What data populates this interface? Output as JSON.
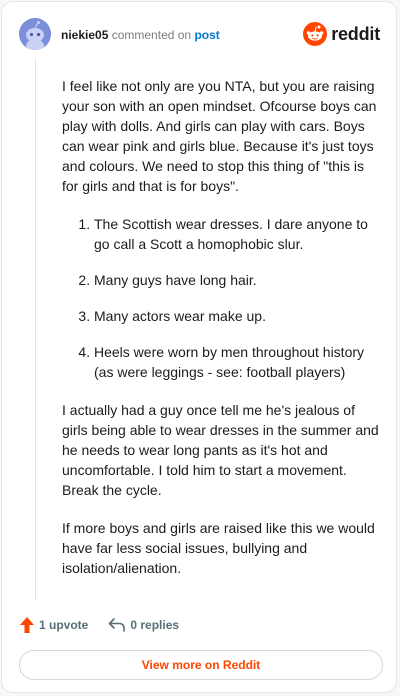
{
  "header": {
    "username": "niekie05",
    "action_text": "commented on",
    "post_link": "post",
    "brand": "reddit"
  },
  "comment": {
    "intro": "I feel like not only are you NTA, but you are raising your son with an open mindset. Ofcourse boys can play with dolls. And girls can play with cars. Boys can wear pink and girls blue. Because it's just toys and colours. We need to stop this thing of \"this is for girls and that is for boys\".",
    "list": [
      "The Scottish wear dresses. I dare anyone to go call a Scott a homophobic slur.",
      "Many guys have long hair.",
      "Many actors wear make up.",
      "Heels were worn by men throughout history (as were leggings - see: football players)"
    ],
    "para2": "I actually had a guy once tell me he's jealous of girls being able to wear dresses in the summer and he needs to wear long pants as it's hot and uncomfortable. I told him to start a movement. Break the cycle.",
    "para3": "If more boys and girls are raised like this we would have far less social issues, bullying and isolation/alienation."
  },
  "actions": {
    "upvote_label": "1 upvote",
    "replies_label": "0 replies"
  },
  "footer": {
    "view_more": "View more on Reddit"
  },
  "colors": {
    "brand": "#ff4500",
    "link": "#0079d3",
    "muted": "#576f76"
  },
  "icons": {
    "avatar": "snoo-avatar-icon",
    "brand": "reddit-logo-icon",
    "upvote": "upvote-arrow-icon",
    "reply": "reply-arrow-icon"
  }
}
